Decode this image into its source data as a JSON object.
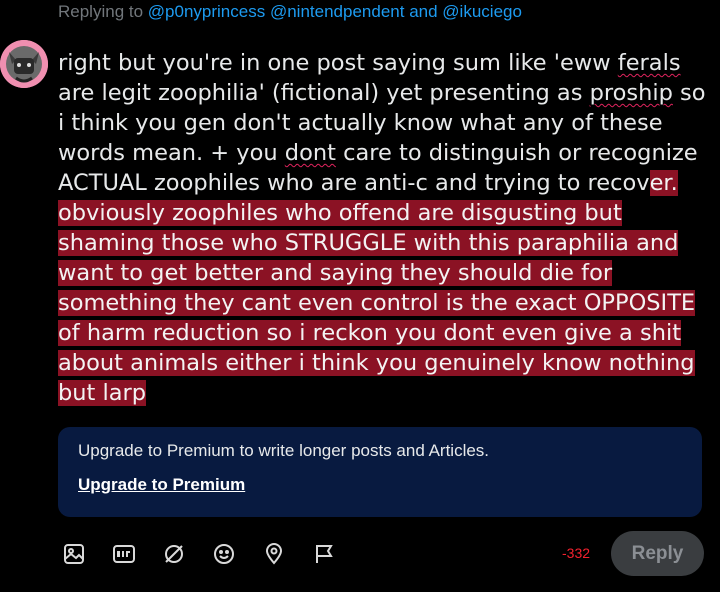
{
  "replying": {
    "prefix": "Replying to",
    "mentions": [
      "@p0nyprincess",
      "@nintendpendent",
      "@ikuciego"
    ],
    "and": "and"
  },
  "post": {
    "plain": [
      "right but you're in one post saying sum like 'eww ",
      "ferals",
      " are legit zoophilia' (fictional) yet presenting as ",
      "proship",
      " so i think you gen don't actually know what any of these words mean. + you ",
      "dont",
      " care to distinguish or recognize ACTUAL zoophiles who are anti-c and trying to recov"
    ],
    "overflow": "er. obviously zoophiles who offend are disgusting but shaming those who STRUGGLE with this paraphilia and want to get better and saying they should die for something they cant even control is the exact OPPOSITE of harm reduction so i reckon you dont even give a shit about animals either i think you genuinely know nothing but larp"
  },
  "premium": {
    "message": "Upgrade to Premium to write longer posts and Articles.",
    "link": "Upgrade to Premium"
  },
  "toolbar": {
    "icons": [
      "image-icon",
      "gif-icon",
      "grok-icon",
      "emoji-icon",
      "location-icon",
      "flag-icon"
    ]
  },
  "counter": "-332",
  "reply_label": "Reply",
  "colors": {
    "background": "#000000",
    "highlight": "#8b1224",
    "mention": "#1d9bf0",
    "premium_bg": "#081a40",
    "counter": "#f4212e"
  }
}
